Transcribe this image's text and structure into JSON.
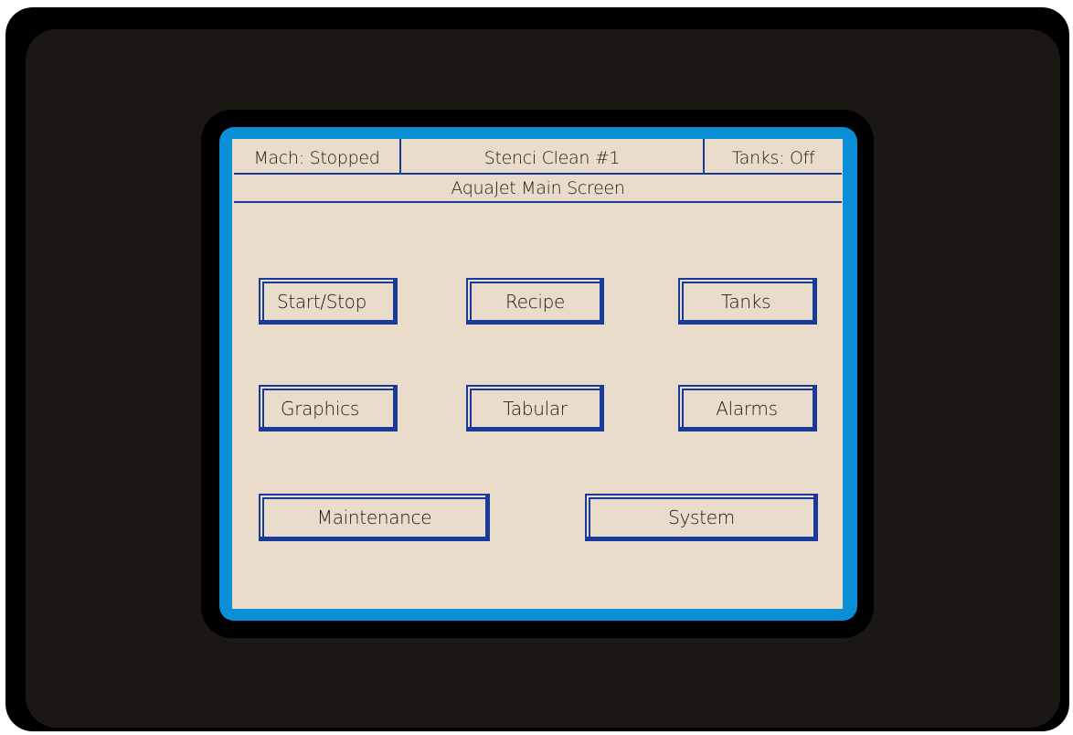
{
  "status": {
    "machine": "Mach: Stopped",
    "recipe": "Stenci Clean #1",
    "tanks": "Tanks: Off"
  },
  "screen_title": "AquaJet Main Screen",
  "buttons": {
    "start_stop": "Start/Stop",
    "recipe": "Recipe",
    "tanks": "Tanks",
    "graphics": "Graphics",
    "tabular": "Tabular",
    "alarms": "Alarms",
    "maintenance": "Maintenance",
    "system": "System"
  },
  "colors": {
    "screen_bg": "#e9dcca",
    "frame": "#0a8fd6",
    "accent": "#1a3a9a"
  }
}
